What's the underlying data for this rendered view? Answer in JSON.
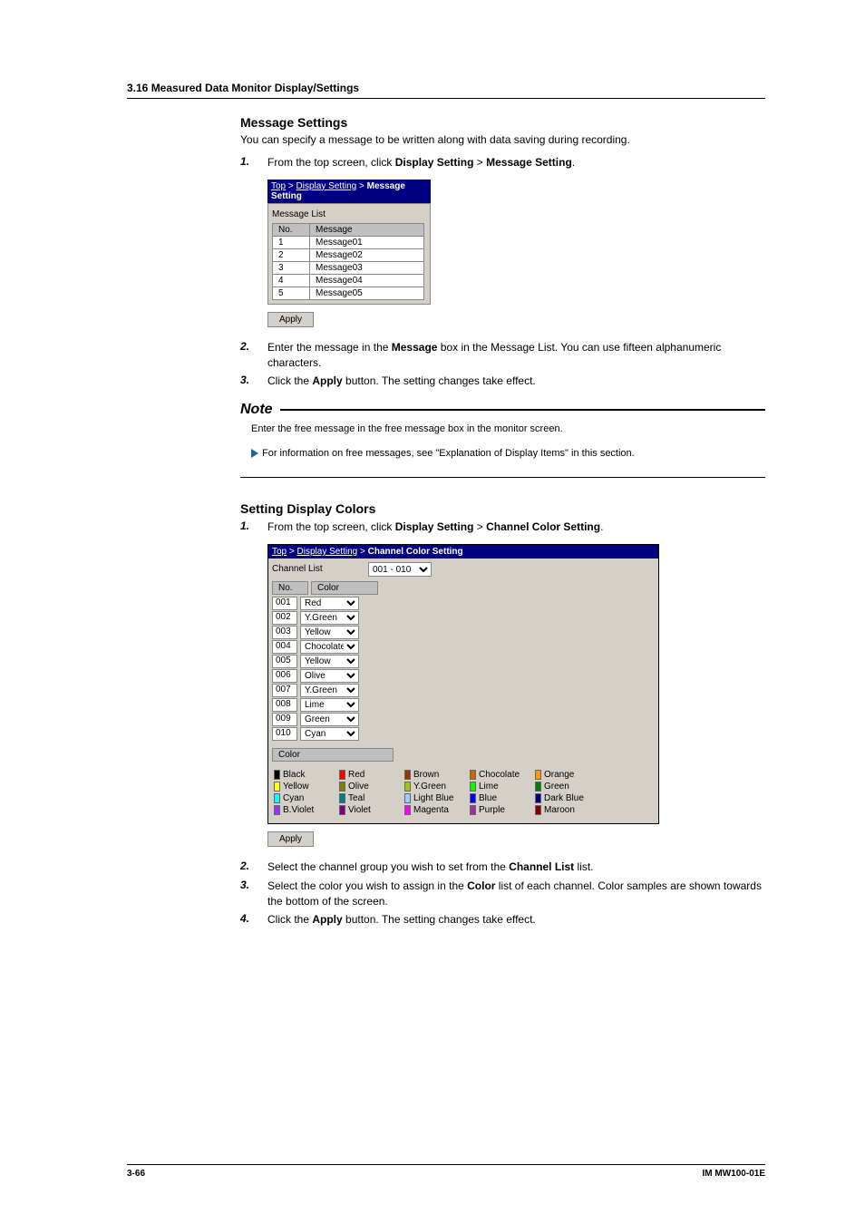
{
  "header": "3.16  Measured Data Monitor Display/Settings",
  "msg": {
    "title": "Message Settings",
    "intro": "You can specify a message to be written along with data saving during recording.",
    "steps": [
      {
        "num": "1.",
        "pre": "From the top screen, click ",
        "b1": "Display Setting",
        "mid": " > ",
        "b2": "Message Setting",
        "post": "."
      },
      {
        "num": "2.",
        "pre": "Enter the message in the ",
        "b1": "Message",
        "post": " box in the Message List. You can use fifteen alphanumeric characters."
      },
      {
        "num": "3.",
        "pre": "Click the ",
        "b1": "Apply",
        "post": " button. The setting changes take effect."
      }
    ],
    "shot": {
      "bc": [
        "Top",
        "Display Setting",
        "Message Setting"
      ],
      "group": "Message List",
      "th_no": "No.",
      "th_msg": "Message",
      "rows": [
        {
          "no": "1",
          "m": "Message01"
        },
        {
          "no": "2",
          "m": "Message02"
        },
        {
          "no": "3",
          "m": "Message03"
        },
        {
          "no": "4",
          "m": "Message04"
        },
        {
          "no": "5",
          "m": "Message05"
        }
      ],
      "apply": "Apply"
    }
  },
  "note": {
    "label": "Note",
    "line1": "Enter the free message in the free message box in the monitor screen.",
    "line2": "For information on free messages, see \"Explanation of Display Items\" in this section."
  },
  "color": {
    "title": "Setting Display Colors",
    "steps": [
      {
        "num": "1.",
        "pre": "From the top screen, click ",
        "b1": "Display Setting",
        "mid": " > ",
        "b2": "Channel Color Setting",
        "post": "."
      },
      {
        "num": "2.",
        "pre": "Select the channel group you wish to set from the ",
        "b1": "Channel List",
        "post": " list."
      },
      {
        "num": "3.",
        "pre": "Select the color you wish to assign in the ",
        "b1": "Color",
        "post": " list of each channel. Color samples are shown towards the bottom of the screen."
      },
      {
        "num": "4.",
        "pre": "Click the ",
        "b1": "Apply",
        "post": " button. The setting changes take effect."
      }
    ],
    "shot": {
      "bc": [
        "Top",
        "Display Setting",
        "Channel Color Setting"
      ],
      "group": "Channel List",
      "range": "001 - 010",
      "th_no": "No.",
      "th_color": "Color",
      "rows": [
        {
          "no": "001",
          "v": "Red"
        },
        {
          "no": "002",
          "v": "Y.Green"
        },
        {
          "no": "003",
          "v": "Yellow"
        },
        {
          "no": "004",
          "v": "Chocolate"
        },
        {
          "no": "005",
          "v": "Yellow"
        },
        {
          "no": "006",
          "v": "Olive"
        },
        {
          "no": "007",
          "v": "Y.Green"
        },
        {
          "no": "008",
          "v": "Lime"
        },
        {
          "no": "009",
          "v": "Green"
        },
        {
          "no": "010",
          "v": "Cyan"
        }
      ],
      "color_label": "Color",
      "palette": [
        [
          {
            "n": "Black",
            "c": "#000000"
          },
          {
            "n": "Red",
            "c": "#ff0000"
          },
          {
            "n": "Brown",
            "c": "#993300"
          },
          {
            "n": "Chocolate",
            "c": "#cc6600"
          },
          {
            "n": "Orange",
            "c": "#ff9900"
          }
        ],
        [
          {
            "n": "Yellow",
            "c": "#ffff00"
          },
          {
            "n": "Olive",
            "c": "#808000"
          },
          {
            "n": "Y.Green",
            "c": "#99cc00"
          },
          {
            "n": "Lime",
            "c": "#00ff00"
          },
          {
            "n": "Green",
            "c": "#008000"
          }
        ],
        [
          {
            "n": "Cyan",
            "c": "#00ffff"
          },
          {
            "n": "Teal",
            "c": "#008080"
          },
          {
            "n": "Light Blue",
            "c": "#99ccff"
          },
          {
            "n": "Blue",
            "c": "#0000ff"
          },
          {
            "n": "Dark Blue",
            "c": "#000080"
          }
        ],
        [
          {
            "n": "B.Violet",
            "c": "#9933ff"
          },
          {
            "n": "Violet",
            "c": "#800080"
          },
          {
            "n": "Magenta",
            "c": "#ff00ff"
          },
          {
            "n": "Purple",
            "c": "#993399"
          },
          {
            "n": "Maroon",
            "c": "#800000"
          }
        ]
      ],
      "apply": "Apply"
    }
  },
  "footer": {
    "page": "3-66",
    "doc": "IM MW100-01E"
  },
  "colormap": {
    "Red": "#ff0000",
    "Y.Green": "#99cc00",
    "Yellow": "#ffff00",
    "Chocolate": "#cc6600",
    "Olive": "#808000",
    "Lime": "#00ff00",
    "Green": "#008000",
    "Cyan": "#00ffff"
  }
}
